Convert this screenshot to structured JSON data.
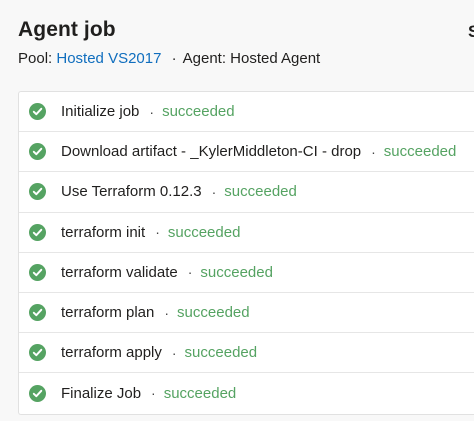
{
  "header": {
    "title": "Agent job",
    "cut_text": "S",
    "pool_label": "Pool:",
    "pool_value": "Hosted VS2017",
    "separator": "·",
    "agent_text": "Agent: Hosted Agent"
  },
  "colors": {
    "success": "#55a362",
    "link": "#106ebe"
  },
  "steps": [
    {
      "name": "Initialize job",
      "sep": "·",
      "status": "succeeded",
      "icon": "check-circle-icon"
    },
    {
      "name": "Download artifact - _KylerMiddleton-CI - drop",
      "sep": "·",
      "status": "succeeded",
      "icon": "check-circle-icon"
    },
    {
      "name": "Use Terraform 0.12.3",
      "sep": "·",
      "status": "succeeded",
      "icon": "check-circle-icon"
    },
    {
      "name": "terraform init",
      "sep": "·",
      "status": "succeeded",
      "icon": "check-circle-icon"
    },
    {
      "name": "terraform validate",
      "sep": "·",
      "status": "succeeded",
      "icon": "check-circle-icon"
    },
    {
      "name": "terraform plan",
      "sep": "·",
      "status": "succeeded",
      "icon": "check-circle-icon"
    },
    {
      "name": "terraform apply",
      "sep": "·",
      "status": "succeeded",
      "icon": "check-circle-icon"
    },
    {
      "name": "Finalize Job",
      "sep": "·",
      "status": "succeeded",
      "icon": "check-circle-icon"
    }
  ]
}
